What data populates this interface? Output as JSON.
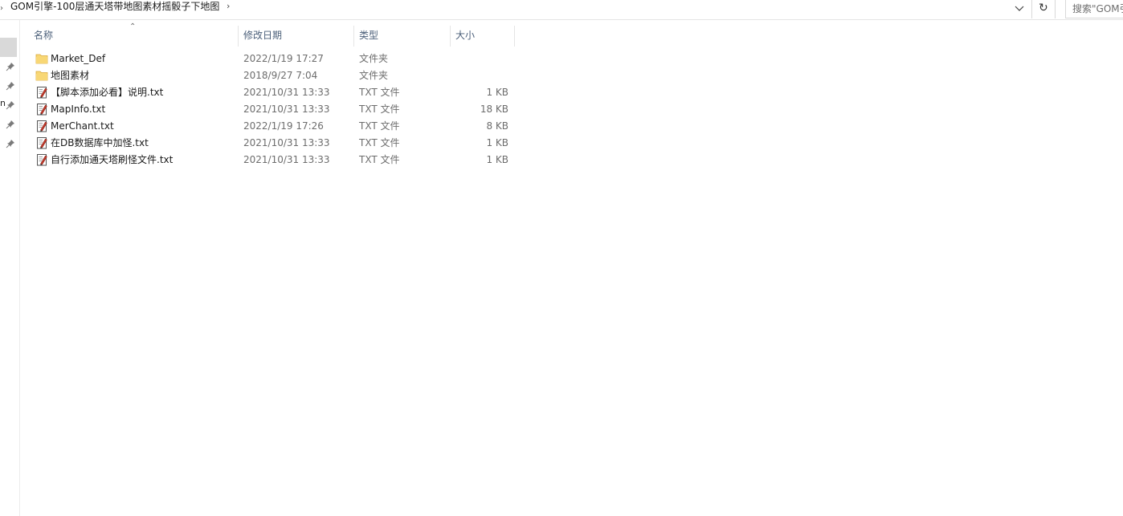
{
  "address": {
    "path": "GOM引擎-100层通天塔带地图素材摇骰子下地图",
    "separator": "›"
  },
  "search": {
    "placeholder": "搜索\"GOM引"
  },
  "refresh_glyph": "↻",
  "nav": {
    "partial_letter": "n"
  },
  "columns": {
    "name": "名称",
    "date": "修改日期",
    "type": "类型",
    "size": "大小"
  },
  "files": [
    {
      "name": "Market_Def",
      "date": "2022/1/19 17:27",
      "type": "文件夹",
      "size": "",
      "icon": "folder-icon"
    },
    {
      "name": "地图素材",
      "date": "2018/9/27 7:04",
      "type": "文件夹",
      "size": "",
      "icon": "folder-icon"
    },
    {
      "name": "【脚本添加必看】说明.txt",
      "date": "2021/10/31 13:33",
      "type": "TXT 文件",
      "size": "1 KB",
      "icon": "text-file-icon"
    },
    {
      "name": "MapInfo.txt",
      "date": "2021/10/31 13:33",
      "type": "TXT 文件",
      "size": "18 KB",
      "icon": "text-file-icon"
    },
    {
      "name": "MerChant.txt",
      "date": "2022/1/19 17:26",
      "type": "TXT 文件",
      "size": "8 KB",
      "icon": "text-file-icon"
    },
    {
      "name": "在DB数据库中加怪.txt",
      "date": "2021/10/31 13:33",
      "type": "TXT 文件",
      "size": "1 KB",
      "icon": "text-file-icon"
    },
    {
      "name": "自行添加通天塔刷怪文件.txt",
      "date": "2021/10/31 13:33",
      "type": "TXT 文件",
      "size": "1 KB",
      "icon": "text-file-icon"
    }
  ],
  "colors": {
    "folder": "#f8d775",
    "header_text": "#4c607a",
    "meta_text": "#6d6d6d",
    "nav_selected": "#d9d9d9"
  }
}
